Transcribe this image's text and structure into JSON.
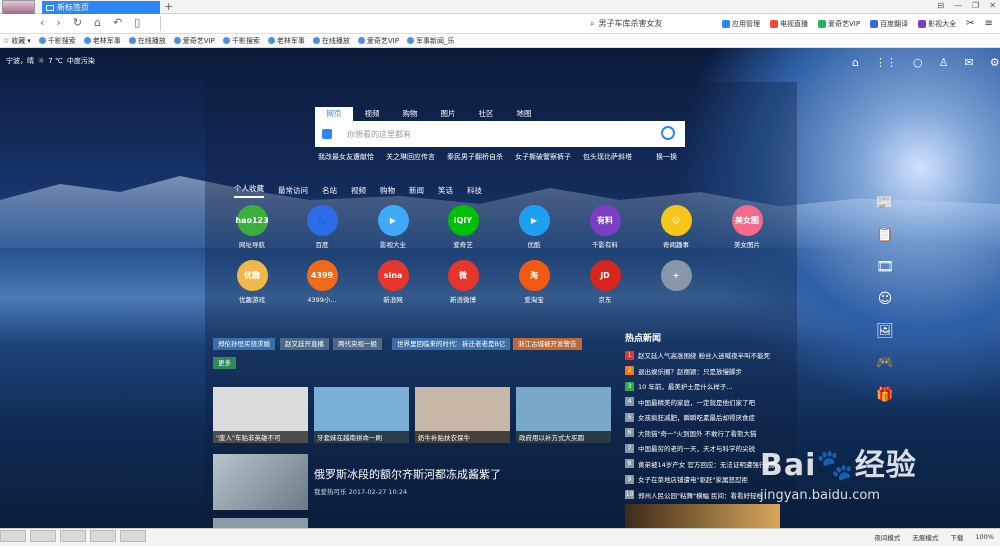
{
  "titlebar": {
    "tab_label": "新标签页",
    "new_tab": "+",
    "window_controls": [
      "⊟",
      "—",
      "❐",
      "✕"
    ]
  },
  "navbar": {
    "back": "‹",
    "forward": "›",
    "refresh": "↻",
    "home": "⌂",
    "undo": "↶",
    "doc": "▯",
    "search_suggestion": "男子车库杀害女友"
  },
  "toolbar": {
    "items": [
      {
        "label": "应用管理",
        "color": "#2e86f6"
      },
      {
        "label": "电视直播",
        "color": "#e94b35"
      },
      {
        "label": "爱奇艺VIP",
        "color": "#1fb35a"
      },
      {
        "label": "百度翻译",
        "color": "#2e6be6"
      },
      {
        "label": "影视大全",
        "color": "#7b3fc4"
      }
    ],
    "scissors": "✂",
    "menu": "≡"
  },
  "bookmarks": {
    "star_label": "收藏",
    "items": [
      "千影搜索",
      "老林军事",
      "在线播放",
      "爱奇艺VIP",
      "千影搜索",
      "老林军事",
      "在线播放",
      "爱奇艺VIP",
      "军事新闻_乐"
    ]
  },
  "weather": {
    "city": "宁波，晴",
    "temp": "7 ℃",
    "air": "中度污染"
  },
  "search": {
    "tabs": [
      "网页",
      "视频",
      "购物",
      "图片",
      "社区",
      "地图"
    ],
    "active_tab": "网页",
    "placeholder": "你想看的这里都有",
    "hot": [
      "我改最女友遭献恰",
      "关之琳回应传言",
      "秦民男子翻桥自杀",
      "女子撕破警察裤子",
      "包头现比萨斜塔"
    ],
    "change": "换一换"
  },
  "categories": {
    "items": [
      "个人收藏",
      "最常访问",
      "名站",
      "视频",
      "购物",
      "新闻",
      "笑话",
      "科技"
    ],
    "active": "个人收藏"
  },
  "apps": [
    {
      "label": "网址导航",
      "text": "hao123",
      "color": "#3cae3c"
    },
    {
      "label": "百度",
      "text": "🐾",
      "color": "#2e6be6"
    },
    {
      "label": "影视大全",
      "text": "▶",
      "color": "#3fa9f5"
    },
    {
      "label": "爱奇艺",
      "text": "iQIY",
      "color": "#00be06"
    },
    {
      "label": "优酷",
      "text": "▶",
      "color": "#1ea0f0"
    },
    {
      "label": "千影有料",
      "text": "有料",
      "color": "#7a3fc4"
    },
    {
      "label": "奇闻趣事",
      "text": "☺",
      "color": "#f5c518"
    },
    {
      "label": "美女图片",
      "text": "美女图",
      "color": "#f26b8a"
    },
    {
      "label": "优趣游戏",
      "text": "优趣",
      "color": "#f0b84a"
    },
    {
      "label": "4399小...",
      "text": "4399",
      "color": "#f06a1a"
    },
    {
      "label": "新浪网",
      "text": "sina",
      "color": "#e8352c"
    },
    {
      "label": "新浪微博",
      "text": "微",
      "color": "#e8352c"
    },
    {
      "label": "爱淘宝",
      "text": "淘",
      "color": "#f25a14"
    },
    {
      "label": "京东",
      "text": "JD",
      "color": "#d7261a"
    },
    {
      "label": "",
      "text": "+",
      "color": "#8a97aa"
    }
  ],
  "tags": [
    {
      "text": "郑伦孙恒买烧求婚",
      "color": "#3a6fa8"
    },
    {
      "text": "赵又廷开直播",
      "color": "#4b6a8a"
    },
    {
      "text": "两代央视一姐",
      "color": "#4b6a8a"
    },
    {
      "text": "世界里回临来的时代？",
      "color": "#3a6fa8"
    },
    {
      "text": "拆迁老老是B亿",
      "color": "#3a6fa8"
    },
    {
      "text": "浙江古城被开发警告",
      "color": "#b86a3a"
    },
    {
      "text": "更多",
      "color": "#2e8a5a"
    }
  ],
  "news_cards": [
    {
      "caption": "\"废人\"车贴非英雄不可",
      "color": "#dcdcdc"
    },
    {
      "caption": "牙套妹在越南拼命一刷",
      "color": "#7ab0d8"
    },
    {
      "caption": "奶牛补贴扶农保牛",
      "color": "#c8b8a8"
    },
    {
      "caption": "政府用以补方式大买圆",
      "color": "#7aa8c8"
    }
  ],
  "feature": {
    "title": "俄罗斯冰段的额尔齐斯河都冻成酱紫了",
    "meta": "我爱热可乐 2017-02-27 10:24"
  },
  "hot_news": {
    "title": "热点新闻",
    "items": [
      {
        "n": "1",
        "text": "赵又廷人气高涨围绕 粉丝入迷喊夜半叫不能死",
        "color": "#e8352c"
      },
      {
        "n": "2",
        "text": "退出娱乐圈？赵丽颖：只是放慢脚步",
        "color": "#f07a1a"
      },
      {
        "n": "3",
        "text": "10 年前，最美护士是什么样子...",
        "color": "#2ea84a"
      },
      {
        "n": "4",
        "text": "中国最精美的家庭，一定就是他们家了吧",
        "color": "#8a97aa"
      },
      {
        "n": "5",
        "text": "女孩疯狂减肥，瞬瞬吃素最后却得厌食症",
        "color": "#8a97aa"
      },
      {
        "n": "6",
        "text": "大熊猫\"奇一\"火到国外 不敢行了看熊大猫",
        "color": "#8a97aa"
      },
      {
        "n": "7",
        "text": "中国最穷的老的一天，天才与科学的尖锐",
        "color": "#8a97aa"
      },
      {
        "n": "8",
        "text": "黄弟被14岁产女 官方回应：无法证明遭强行(图)",
        "color": "#8a97aa"
      },
      {
        "n": "9",
        "text": "女子在菜地店铺遭电\"驱赶\"家属怒怼拒",
        "color": "#8a97aa"
      },
      {
        "n": "10",
        "text": "郑州人民公园\"粘舞\"横幅 民间：看看好轻松",
        "color": "#8a97aa"
      }
    ]
  },
  "sidebar_icons": [
    "📰",
    "📋",
    "🎞",
    "☺",
    "🖼",
    "🎮",
    "🎁"
  ],
  "watermark": {
    "brand": "Bai🐾经验",
    "url": "jingyan.baidu.com"
  },
  "status": {
    "items": [
      "夜间模式",
      "无痕模式",
      "下载",
      "100%"
    ]
  }
}
